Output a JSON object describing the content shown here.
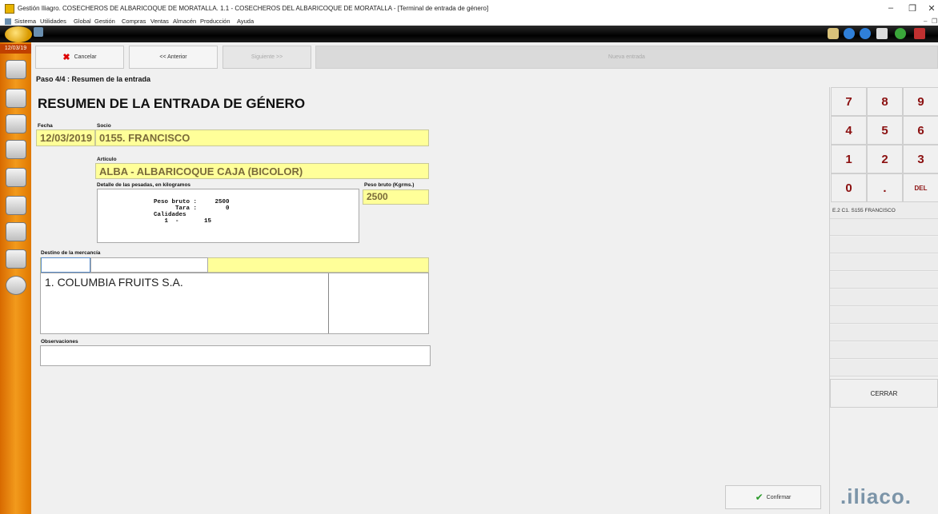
{
  "window": {
    "title": "Gestión Iliagro. COSECHEROS DE ALBARICOQUE DE MORATALLA. 1.1 - COSECHEROS DEL ALBARICOQUE DE MORATALLA - [Terminal de entrada de género]",
    "minimize": "–",
    "restore": "❐",
    "close": "✕"
  },
  "menu": {
    "items": [
      "Sistema",
      "Utilidades",
      "Global",
      "Gestión",
      "Compras",
      "Ventas",
      "Almacén",
      "Producción",
      "Ayuda"
    ],
    "mdi_minimize": "–",
    "mdi_restore": "❐"
  },
  "sidebar": {
    "date": "12/03/19"
  },
  "nav": {
    "cancel": "Cancelar",
    "cancel_icon": "✖",
    "previous": "<< Anterior",
    "next": "Siguiente >>",
    "new_entry": "Nueva entrada"
  },
  "step": "Paso 4/4 : Resumen  de la entrada",
  "heading": "RESUMEN DE LA ENTRADA DE GÉNERO",
  "form": {
    "fecha_label": "Fecha",
    "fecha": "12/03/2019",
    "socio_label": "Socio",
    "socio": "0155. FRANCISCO",
    "articulo_label": "Artículo",
    "articulo": "ALBA - ALBARICOQUE CAJA (BICOLOR)",
    "detalle_label": "Detalle de las pesadas, en kilogramos",
    "detalle": "Peso bruto :     2500\n      Tara :        0\nCalidades\n   1  -       15",
    "peso_label": "Peso bruto (Kgrms.)",
    "peso": "2500",
    "destino_label": "Destino de la mercancía",
    "destino_item": "1. COLUMBIA FRUITS S.A.",
    "obs_label": "Observaciones"
  },
  "keypad": {
    "keys": [
      "7",
      "8",
      "9",
      "4",
      "5",
      "6",
      "1",
      "2",
      "3",
      "0",
      ".",
      "DEL"
    ],
    "list_first": "E.2 C1. S155 FRANCISCO",
    "close": "CERRAR"
  },
  "footer": {
    "confirm": "Confirmar",
    "confirm_icon": "✔",
    "brand": ".iliaco."
  },
  "colors": {
    "field_yellow": "#ffff99",
    "sidebar_orange": "#f29a1c",
    "keypad_digit": "#8b1010"
  }
}
